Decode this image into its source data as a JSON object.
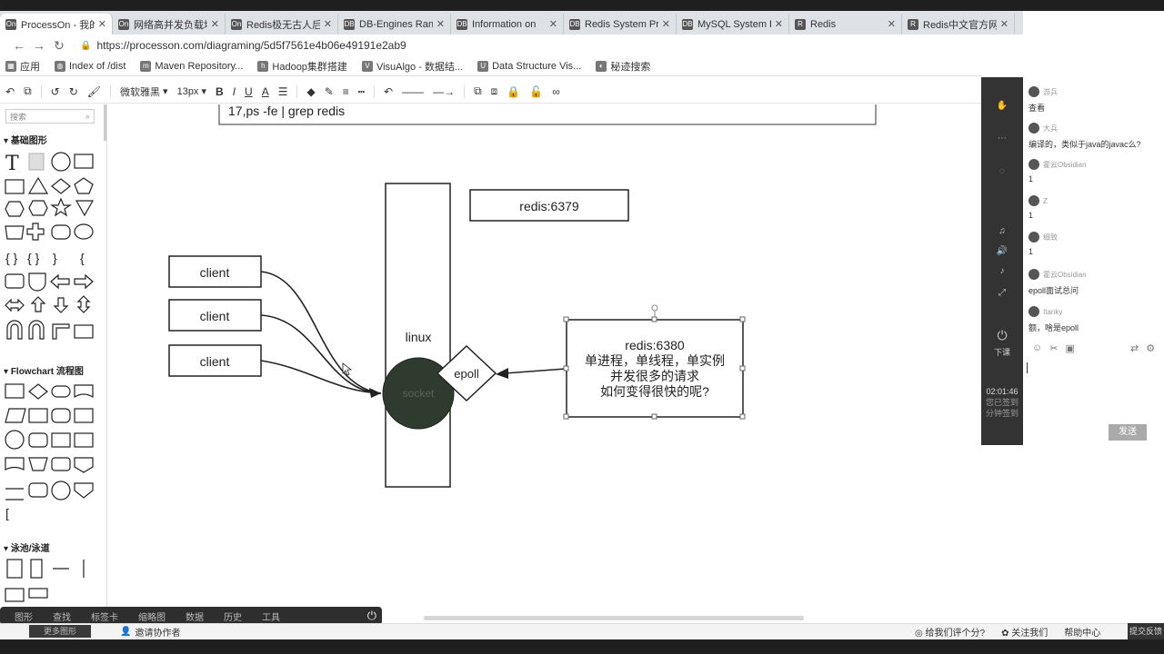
{
  "browser": {
    "tabs": [
      {
        "icon": "On",
        "title": "ProcessOn - 我的"
      },
      {
        "icon": "On",
        "title": "网络高并发负载均"
      },
      {
        "icon": "On",
        "title": "Redis极无古人后"
      },
      {
        "icon": "DB",
        "title": "DB-Engines Rank"
      },
      {
        "icon": "DB",
        "title": "Information on"
      },
      {
        "icon": "DB",
        "title": "Redis System Pro"
      },
      {
        "icon": "DB",
        "title": "MySQL System P"
      },
      {
        "icon": "R",
        "title": "Redis"
      },
      {
        "icon": "R",
        "title": "Redis中文官方网站"
      }
    ],
    "new_tab": "+",
    "window_controls": [
      "—",
      "❐",
      "✕"
    ],
    "url": "https://processon.com/diagraming/5d5f7561e4b06e49191e2ab9",
    "bookmarks": [
      "应用",
      "Index of /dist",
      "Maven Repository...",
      "Hadoop集群搭建",
      "VisuAlgo - 数据结...",
      "Data Structure Vis...",
      "秘迹搜索"
    ]
  },
  "toolbar": {
    "font": "微软雅黑",
    "font_size": "13px",
    "bold": "B",
    "italic": "I",
    "underline": "U",
    "font_color": "A"
  },
  "left_panel": {
    "search_placeholder": "搜索",
    "sections": [
      "基础图形",
      "Flowchart 流程图",
      "泳池/泳道"
    ]
  },
  "diagram": {
    "command_text": "17,ps -fe |  grep redis",
    "clients": [
      "client",
      "client",
      "client"
    ],
    "linux_label": "linux",
    "socket_label": "socket",
    "epoll_label": "epoll",
    "redis_top": "redis:6379",
    "redis_box_lines": [
      "redis:6380",
      "单进程，单线程，单实例",
      "并发很多的请求",
      "如何变得很快的呢?"
    ]
  },
  "dock": {
    "items": [
      "图形",
      "查找",
      "标签卡",
      "缩略图",
      "数据",
      "历史",
      "工具"
    ]
  },
  "status": {
    "more_shapes": "更多图形",
    "invite": "邀请协作者",
    "rate": "给我们评个分?",
    "follow": "关注我们",
    "help": "帮助中心",
    "feedback": "提交反馈"
  },
  "live_panel": {
    "time": "02:01:46",
    "time_sub1": "您已签到",
    "time_sub2": "分钟签到",
    "download_label": "下课",
    "messages": [
      {
        "user": "游兵",
        "text": "查看"
      },
      {
        "user": "大兵",
        "text": "编译的，类似于java的javac么?"
      },
      {
        "user": "霍云Obsidian",
        "text": "1"
      },
      {
        "user": "Z",
        "text": "1"
      },
      {
        "user": "细致",
        "text": "1"
      },
      {
        "user": "霍云Obsidian",
        "text": "epoll面试总问"
      },
      {
        "user": "Itanky",
        "text": "额，啥是epoll"
      }
    ],
    "send": "发送"
  }
}
